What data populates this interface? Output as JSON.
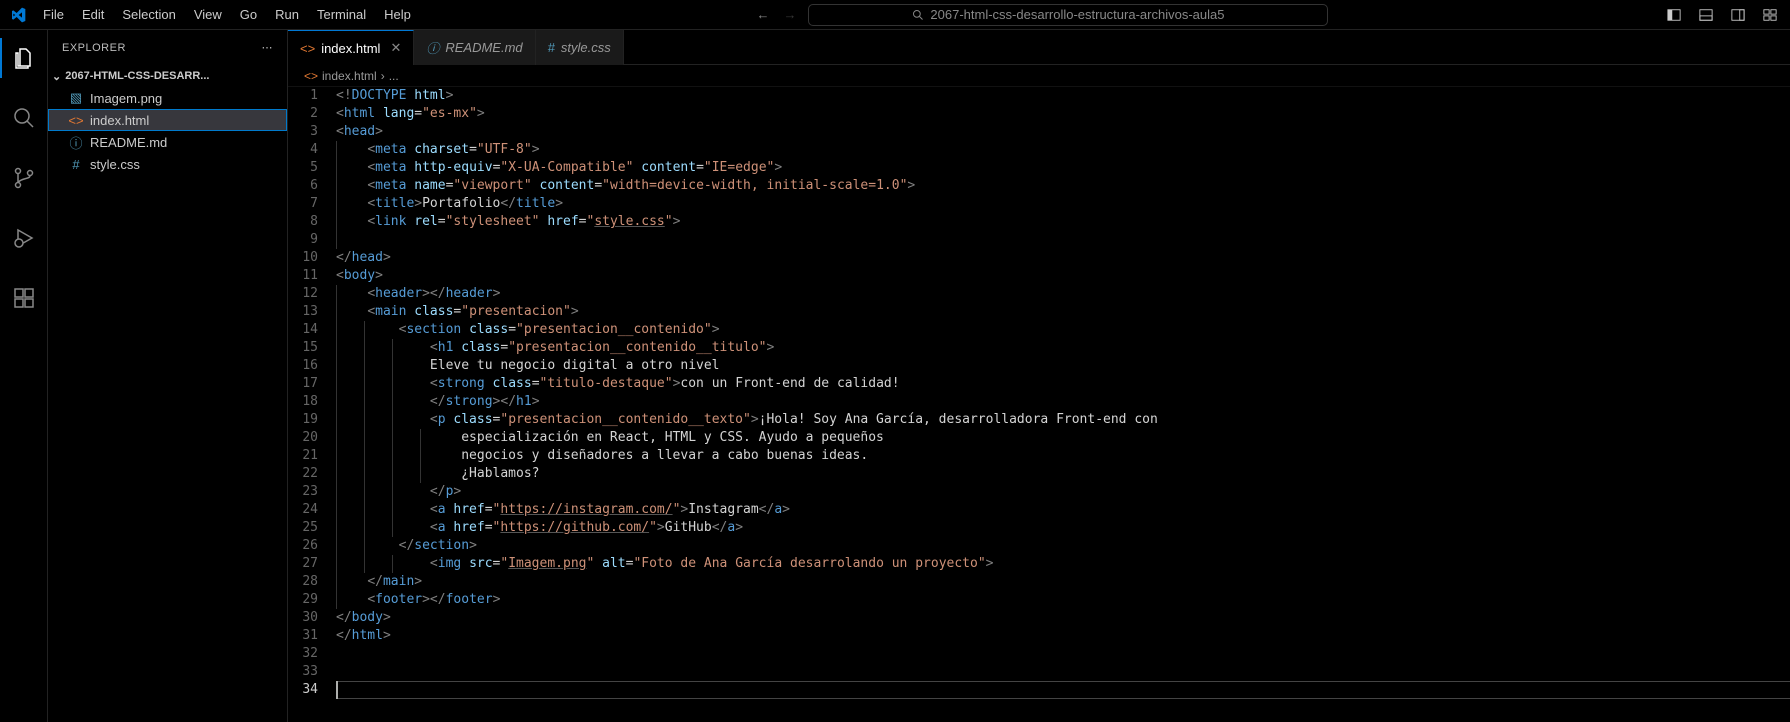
{
  "titlebar": {
    "menu": [
      "File",
      "Edit",
      "Selection",
      "View",
      "Go",
      "Run",
      "Terminal",
      "Help"
    ],
    "search_text": "2067-html-css-desarrollo-estructura-archivos-aula5"
  },
  "activitybar": {
    "items": [
      "explorer",
      "search",
      "source-control",
      "run-debug",
      "extensions"
    ]
  },
  "sidebar": {
    "title": "EXPLORER",
    "folder": "2067-HTML-CSS-DESARR...",
    "files": [
      {
        "name": "Imagem.png",
        "icon": "image",
        "color": "ic-blue"
      },
      {
        "name": "index.html",
        "icon": "html",
        "color": "ic-orange",
        "active": true
      },
      {
        "name": "README.md",
        "icon": "info",
        "color": "ic-info"
      },
      {
        "name": "style.css",
        "icon": "hash",
        "color": "ic-blue"
      }
    ]
  },
  "tabs": [
    {
      "label": "index.html",
      "icon": "html",
      "active": true,
      "close": true
    },
    {
      "label": "README.md",
      "icon": "info",
      "italic": true
    },
    {
      "label": "style.css",
      "icon": "hash"
    }
  ],
  "breadcrumb": {
    "file": "index.html",
    "sep": "›",
    "dots": "..."
  },
  "code": {
    "line_count": 34,
    "current_line": 34,
    "lines": {
      "1": [
        [
          "c-gray",
          "<!"
        ],
        [
          "c-doctype",
          "DOCTYPE"
        ],
        [
          "c-txt",
          " "
        ],
        [
          "c-attr",
          "html"
        ],
        [
          "c-gray",
          ">"
        ]
      ],
      "2": [
        [
          "c-gray",
          "<"
        ],
        [
          "c-tag",
          "html"
        ],
        [
          "c-txt",
          " "
        ],
        [
          "c-attr",
          "lang"
        ],
        [
          "c-txt",
          "="
        ],
        [
          "c-str",
          "\"es-mx\""
        ],
        [
          "c-gray",
          ">"
        ]
      ],
      "3": [
        [
          "c-gray",
          "<"
        ],
        [
          "c-tag",
          "head"
        ],
        [
          "c-gray",
          ">"
        ]
      ],
      "4": [
        [
          "c-txt",
          "    "
        ],
        [
          "c-gray",
          "<"
        ],
        [
          "c-tag",
          "meta"
        ],
        [
          "c-txt",
          " "
        ],
        [
          "c-attr",
          "charset"
        ],
        [
          "c-txt",
          "="
        ],
        [
          "c-str",
          "\"UTF-8\""
        ],
        [
          "c-gray",
          ">"
        ]
      ],
      "5": [
        [
          "c-txt",
          "    "
        ],
        [
          "c-gray",
          "<"
        ],
        [
          "c-tag",
          "meta"
        ],
        [
          "c-txt",
          " "
        ],
        [
          "c-attr",
          "http-equiv"
        ],
        [
          "c-txt",
          "="
        ],
        [
          "c-str",
          "\"X-UA-Compatible\""
        ],
        [
          "c-txt",
          " "
        ],
        [
          "c-attr",
          "content"
        ],
        [
          "c-txt",
          "="
        ],
        [
          "c-str",
          "\"IE=edge\""
        ],
        [
          "c-gray",
          ">"
        ]
      ],
      "6": [
        [
          "c-txt",
          "    "
        ],
        [
          "c-gray",
          "<"
        ],
        [
          "c-tag",
          "meta"
        ],
        [
          "c-txt",
          " "
        ],
        [
          "c-attr",
          "name"
        ],
        [
          "c-txt",
          "="
        ],
        [
          "c-str",
          "\"viewport\""
        ],
        [
          "c-txt",
          " "
        ],
        [
          "c-attr",
          "content"
        ],
        [
          "c-txt",
          "="
        ],
        [
          "c-str",
          "\"width=device-width, initial-scale=1.0\""
        ],
        [
          "c-gray",
          ">"
        ]
      ],
      "7": [
        [
          "c-txt",
          "    "
        ],
        [
          "c-gray",
          "<"
        ],
        [
          "c-tag",
          "title"
        ],
        [
          "c-gray",
          ">"
        ],
        [
          "c-txt",
          "Portafolio"
        ],
        [
          "c-gray",
          "</"
        ],
        [
          "c-tag",
          "title"
        ],
        [
          "c-gray",
          ">"
        ]
      ],
      "8": [
        [
          "c-txt",
          "    "
        ],
        [
          "c-gray",
          "<"
        ],
        [
          "c-tag",
          "link"
        ],
        [
          "c-txt",
          " "
        ],
        [
          "c-attr",
          "rel"
        ],
        [
          "c-txt",
          "="
        ],
        [
          "c-str",
          "\"stylesheet\""
        ],
        [
          "c-txt",
          " "
        ],
        [
          "c-attr",
          "href"
        ],
        [
          "c-txt",
          "="
        ],
        [
          "c-str",
          "\""
        ],
        [
          "c-link",
          "style.css"
        ],
        [
          "c-str",
          "\""
        ],
        [
          "c-gray",
          ">"
        ]
      ],
      "9": [],
      "10": [
        [
          "c-gray",
          "</"
        ],
        [
          "c-tag",
          "head"
        ],
        [
          "c-gray",
          ">"
        ]
      ],
      "11": [
        [
          "c-gray",
          "<"
        ],
        [
          "c-tag",
          "body"
        ],
        [
          "c-gray",
          ">"
        ]
      ],
      "12": [
        [
          "c-txt",
          "    "
        ],
        [
          "c-gray",
          "<"
        ],
        [
          "c-tag",
          "header"
        ],
        [
          "c-gray",
          "></"
        ],
        [
          "c-tag",
          "header"
        ],
        [
          "c-gray",
          ">"
        ]
      ],
      "13": [
        [
          "c-txt",
          "    "
        ],
        [
          "c-gray",
          "<"
        ],
        [
          "c-tag",
          "main"
        ],
        [
          "c-txt",
          " "
        ],
        [
          "c-attr",
          "class"
        ],
        [
          "c-txt",
          "="
        ],
        [
          "c-str",
          "\"presentacion\""
        ],
        [
          "c-gray",
          ">"
        ]
      ],
      "14": [
        [
          "c-txt",
          "        "
        ],
        [
          "c-gray",
          "<"
        ],
        [
          "c-tag",
          "section"
        ],
        [
          "c-txt",
          " "
        ],
        [
          "c-attr",
          "class"
        ],
        [
          "c-txt",
          "="
        ],
        [
          "c-str",
          "\"presentacion__contenido\""
        ],
        [
          "c-gray",
          ">"
        ]
      ],
      "15": [
        [
          "c-txt",
          "            "
        ],
        [
          "c-gray",
          "<"
        ],
        [
          "c-tag",
          "h1"
        ],
        [
          "c-txt",
          " "
        ],
        [
          "c-attr",
          "class"
        ],
        [
          "c-txt",
          "="
        ],
        [
          "c-str",
          "\"presentacion__contenido__titulo\""
        ],
        [
          "c-gray",
          ">"
        ]
      ],
      "16": [
        [
          "c-txt",
          "            Eleve tu negocio digital a otro nivel"
        ]
      ],
      "17": [
        [
          "c-txt",
          "            "
        ],
        [
          "c-gray",
          "<"
        ],
        [
          "c-tag",
          "strong"
        ],
        [
          "c-txt",
          " "
        ],
        [
          "c-attr",
          "class"
        ],
        [
          "c-txt",
          "="
        ],
        [
          "c-str",
          "\"titulo-destaque\""
        ],
        [
          "c-gray",
          ">"
        ],
        [
          "c-txt",
          "con un Front-end de calidad!"
        ]
      ],
      "18": [
        [
          "c-txt",
          "            "
        ],
        [
          "c-gray",
          "</"
        ],
        [
          "c-tag",
          "strong"
        ],
        [
          "c-gray",
          "></"
        ],
        [
          "c-tag",
          "h1"
        ],
        [
          "c-gray",
          ">"
        ]
      ],
      "19": [
        [
          "c-txt",
          "            "
        ],
        [
          "c-gray",
          "<"
        ],
        [
          "c-tag",
          "p"
        ],
        [
          "c-txt",
          " "
        ],
        [
          "c-attr",
          "class"
        ],
        [
          "c-txt",
          "="
        ],
        [
          "c-str",
          "\"presentacion__contenido__texto\""
        ],
        [
          "c-gray",
          ">"
        ],
        [
          "c-txt",
          "¡Hola! Soy Ana García, desarrolladora Front-end con"
        ]
      ],
      "20": [
        [
          "c-txt",
          "                especialización en React, HTML y CSS. Ayudo a pequeños"
        ]
      ],
      "21": [
        [
          "c-txt",
          "                negocios y diseñadores a llevar a cabo buenas ideas."
        ]
      ],
      "22": [
        [
          "c-txt",
          "                ¿Hablamos?"
        ]
      ],
      "23": [
        [
          "c-txt",
          "            "
        ],
        [
          "c-gray",
          "</"
        ],
        [
          "c-tag",
          "p"
        ],
        [
          "c-gray",
          ">"
        ]
      ],
      "24": [
        [
          "c-txt",
          "            "
        ],
        [
          "c-gray",
          "<"
        ],
        [
          "c-tag",
          "a"
        ],
        [
          "c-txt",
          " "
        ],
        [
          "c-attr",
          "href"
        ],
        [
          "c-txt",
          "="
        ],
        [
          "c-str",
          "\""
        ],
        [
          "c-link",
          "https://instagram.com/"
        ],
        [
          "c-str",
          "\""
        ],
        [
          "c-gray",
          ">"
        ],
        [
          "c-txt",
          "Instagram"
        ],
        [
          "c-gray",
          "</"
        ],
        [
          "c-tag",
          "a"
        ],
        [
          "c-gray",
          ">"
        ]
      ],
      "25": [
        [
          "c-txt",
          "            "
        ],
        [
          "c-gray",
          "<"
        ],
        [
          "c-tag",
          "a"
        ],
        [
          "c-txt",
          " "
        ],
        [
          "c-attr",
          "href"
        ],
        [
          "c-txt",
          "="
        ],
        [
          "c-str",
          "\""
        ],
        [
          "c-link",
          "https://github.com/"
        ],
        [
          "c-str",
          "\""
        ],
        [
          "c-gray",
          ">"
        ],
        [
          "c-txt",
          "GitHub"
        ],
        [
          "c-gray",
          "</"
        ],
        [
          "c-tag",
          "a"
        ],
        [
          "c-gray",
          ">"
        ]
      ],
      "26": [
        [
          "c-txt",
          "        "
        ],
        [
          "c-gray",
          "</"
        ],
        [
          "c-tag",
          "section"
        ],
        [
          "c-gray",
          ">"
        ]
      ],
      "27": [
        [
          "c-txt",
          "            "
        ],
        [
          "c-gray",
          "<"
        ],
        [
          "c-tag",
          "img"
        ],
        [
          "c-txt",
          " "
        ],
        [
          "c-attr",
          "src"
        ],
        [
          "c-txt",
          "="
        ],
        [
          "c-str",
          "\""
        ],
        [
          "c-link",
          "Imagem.png"
        ],
        [
          "c-str",
          "\""
        ],
        [
          "c-txt",
          " "
        ],
        [
          "c-attr",
          "alt"
        ],
        [
          "c-txt",
          "="
        ],
        [
          "c-str",
          "\"Foto de Ana García desarrolando un proyecto\""
        ],
        [
          "c-gray",
          ">"
        ]
      ],
      "28": [
        [
          "c-txt",
          "    "
        ],
        [
          "c-gray",
          "</"
        ],
        [
          "c-tag",
          "main"
        ],
        [
          "c-gray",
          ">"
        ]
      ],
      "29": [
        [
          "c-txt",
          "    "
        ],
        [
          "c-gray",
          "<"
        ],
        [
          "c-tag",
          "footer"
        ],
        [
          "c-gray",
          "></"
        ],
        [
          "c-tag",
          "footer"
        ],
        [
          "c-gray",
          ">"
        ]
      ],
      "30": [
        [
          "c-gray",
          "</"
        ],
        [
          "c-tag",
          "body"
        ],
        [
          "c-gray",
          ">"
        ]
      ],
      "31": [
        [
          "c-gray",
          "</"
        ],
        [
          "c-tag",
          "html"
        ],
        [
          "c-gray",
          ">"
        ]
      ],
      "32": [],
      "33": []
    },
    "indents": {
      "4": 1,
      "5": 1,
      "6": 1,
      "7": 1,
      "8": 1,
      "9": 1,
      "12": 1,
      "13": 1,
      "14": 2,
      "15": 3,
      "16": 3,
      "17": 3,
      "18": 3,
      "19": 3,
      "20": 4,
      "21": 4,
      "22": 4,
      "23": 3,
      "24": 3,
      "25": 3,
      "26": 2,
      "27": 3,
      "28": 1,
      "29": 1
    }
  }
}
